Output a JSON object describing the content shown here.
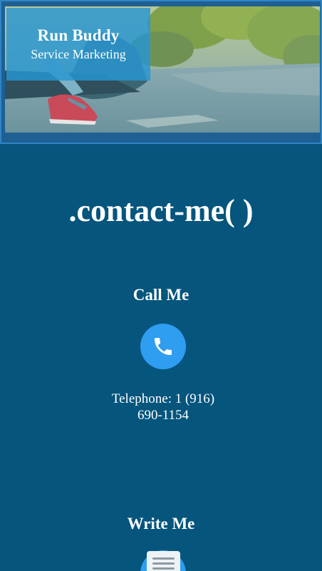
{
  "hero": {
    "brand_title": "Run Buddy",
    "brand_subtitle": "Service Marketing"
  },
  "contact": {
    "title": ".contact-me( )",
    "call_heading": "Call Me",
    "phone_line1": "Telephone: 1 (916)",
    "phone_line2": "690-1154",
    "write_heading": "Write Me"
  },
  "icons": {
    "phone": "phone-icon",
    "mail": "mail-icon"
  },
  "colors": {
    "background": "#05557d",
    "hero_border": "#2e84c6",
    "brand_box": "#2796d2",
    "icon_circle": "#2f9df0",
    "text": "#ffffff"
  }
}
